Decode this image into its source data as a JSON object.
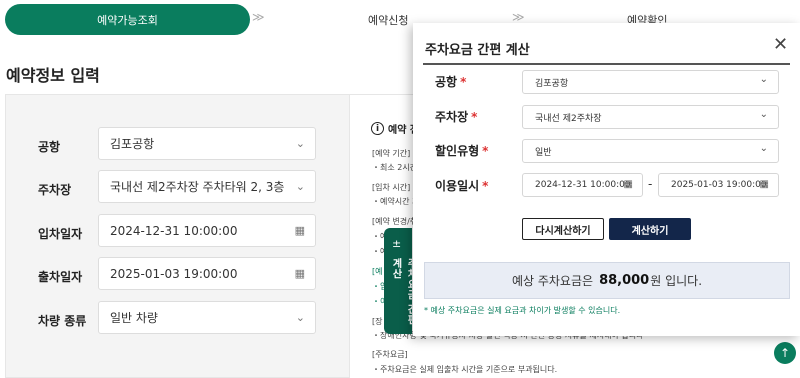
{
  "steps": {
    "active": "예약가능조회",
    "second": "예약신청",
    "third": "예약확인",
    "arrow": "≫"
  },
  "page_title": "예약정보 입력",
  "form": {
    "rows": [
      {
        "label": "공항",
        "value": "김포공항",
        "icon": "chevron-down-icon"
      },
      {
        "label": "주차장",
        "value": "국내선 제2주차장 주차타워 2, 3층",
        "icon": "chevron-down-icon"
      },
      {
        "label": "입차일자",
        "value": "2024-12-31 10:00:00",
        "icon": "calendar-icon"
      },
      {
        "label": "출차일자",
        "value": "2025-01-03 19:00:00",
        "icon": "calendar-icon"
      },
      {
        "label": "차량 종류",
        "value": "일반 차량",
        "icon": "chevron-down-icon"
      }
    ]
  },
  "info": {
    "heading": "예약 전",
    "lines": [
      "[예약 기간]",
      "・최소 2시간",
      "[입차 시간]",
      "・예약시간 기",
      "[예약 변경/취",
      "・예",
      "・예",
      "[예",
      "・입",
      "・이",
      "[장",
      "・장애인차량 및 국가유공자 차량 할인 적용 시 관련 증빙 서류를 제시해야 합니다.",
      "[주차요금]",
      "・주차요금은 실제 입출차 시간을 기준으로 부과됩니다."
    ]
  },
  "side_tab": {
    "label": "주차요금 간편계산",
    "icon": "calculator-icon"
  },
  "modal": {
    "title": "주차요금 간편 계산",
    "close": "✕",
    "airport_label": "공항",
    "airport_value": "김포공항",
    "lot_label": "주차장",
    "lot_value": "국내선 제2주차장",
    "discount_label": "할인유형",
    "discount_value": "일반",
    "period_label": "이용일시",
    "start": "2024-12-31 10:00:00",
    "end": "2025-01-03 19:00:00",
    "tilde": "-",
    "required_mark": "*",
    "reset_btn": "다시계산하기",
    "calc_btn": "계산하기",
    "result_prefix": "예상 주차요금은",
    "result_amount": "88,000",
    "result_suffix": "원 입니다.",
    "note": "* 예상 주차요금은 실제 요금과 차이가 발생할 수 있습니다."
  },
  "colors": {
    "brand_green": "#0a7d5e",
    "navy_button": "#13264a",
    "required_red": "#d33333"
  }
}
